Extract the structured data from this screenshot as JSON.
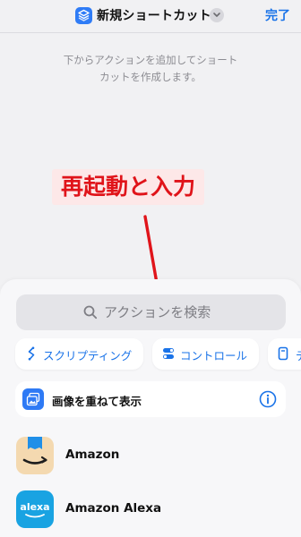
{
  "header": {
    "title": "新規ショートカット",
    "done_label": "完了",
    "app_icon": "shortcuts-layers-icon",
    "chevron_icon": "chevron-down-icon"
  },
  "hint": {
    "line1": "下からアクションを追加してショート",
    "line2": "カットを作成します。"
  },
  "annotation": {
    "text": "再起動と入力",
    "color": "#e0141a",
    "background": "#fde8e8"
  },
  "search": {
    "placeholder": "アクションを検索",
    "value": ""
  },
  "categories": [
    {
      "label": "スクリプティング",
      "icon": "scripting-icon"
    },
    {
      "label": "コントロール",
      "icon": "toggle-icon"
    },
    {
      "label": "デ",
      "icon": "document-icon"
    }
  ],
  "suggestion": {
    "label": "画像を重ねて表示",
    "icon": "overlay-images-icon",
    "info_icon": "info-icon"
  },
  "apps": [
    {
      "label": "Amazon",
      "icon": "amazon-icon"
    },
    {
      "label": "Amazon Alexa",
      "icon": "alexa-icon",
      "icon_text": "alexa"
    }
  ],
  "colors": {
    "accent": "#1a73e8",
    "annotation_red": "#e0141a"
  }
}
